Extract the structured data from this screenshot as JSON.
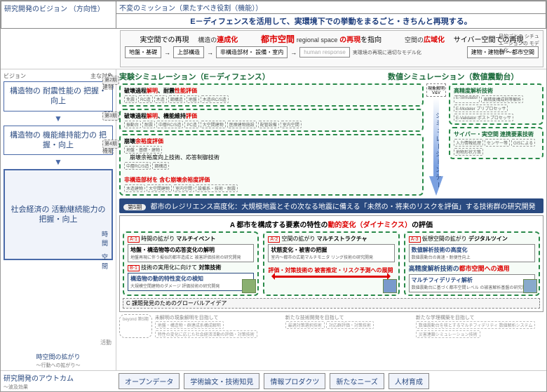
{
  "header": {
    "vision_title": "研究開発のビジョン\n（方向性）",
    "mission_title": "不変のミッション（果たすべき役割（機能））",
    "mission_body": "E－ディフェンスを活用して、実環境下での挙動をまるごと・きちんと再現する。"
  },
  "row2": {
    "t_real": "実空間での再現",
    "t_struct": "構造の",
    "t_speed": "連成化",
    "t_city": "都市空間",
    "t_city_en": "regional space",
    "t_repr": "の再現",
    "t_aim": "を指向",
    "t_wide": "空間の",
    "t_wide2": "広域化",
    "t_cyber": "サイバー空間での再現",
    "b1": "地盤・基礎",
    "b2": "上部構造",
    "b3": "非構造部材・\n設備・室内",
    "b4": "human\nresponse",
    "b_right": "建物・建物群\n～都市空間",
    "caption": "実環境の再現に適切なモデル化",
    "right_cap": "目的ごとの\nシチュエーションの\nモデル化"
  },
  "left": {
    "l_vision": "ビジョン",
    "l_target": "主な対象",
    "box1": "構造物の\n耐震性能の\n把握・向上",
    "box2": "構造物の\n機能維持能力の\n把握・向上",
    "box3": "社会経済の\n活動継続能力の\n把握・向上",
    "bottom": "時空間の拡がり",
    "bottom_sub": "～行動への拡がり～"
  },
  "side": {
    "s2": "建物",
    "s3": "機能",
    "s_ts": "時間\n空間",
    "s_act": "活動"
  },
  "phases": {
    "p2": "第2期",
    "p3": "第3期",
    "p4": "第4期",
    "p5": "第5期",
    "beyond": "beyond\n第5期"
  },
  "sections": {
    "exp": "実験シミュレーション（E－ディフェンス）",
    "num": "数値シミュレーション（数値震動台）"
  },
  "exp_blocks": {
    "b1_t1": "破壊過程",
    "b1_t2": "解明",
    "b1_t3": "、耐震",
    "b1_t4": "性能評価",
    "b1_tags": [
      "免震",
      "RC造",
      "木造",
      "鋼構造",
      "地盤",
      "木造/RC/S造"
    ],
    "b2_t1": "破壊過程",
    "b2_t2": "解明",
    "b2_t3": "、機能維持",
    "b2_t4": "評価",
    "b2_tags": [
      "振動台",
      "耐震",
      "中層RC/S造",
      "PC造",
      "大空間建物",
      "医療建物施設",
      "配管設備",
      "室内空間"
    ],
    "b3_t1": "崩壊",
    "b3_t2": "余裕度評価",
    "b3_tags": [
      "地盤・基礎・建物"
    ],
    "b3_sub": "崩壊余裕度向上技術、応答制御技術",
    "b3_subtags": [
      "中層RC/S造",
      "鋼構造"
    ],
    "b3_t3": "非構造部材を\n含む崩壊余裕度評価",
    "b3_tags2": [
      "木造建物",
      "大空間建物",
      "室内空間",
      "設備系・技術・耐震"
    ]
  },
  "num_blocks": {
    "n1_t": "高精度解析技術",
    "n1_items": [
      "E-Simulator",
      "高精度構成則等解析",
      "E-Modeler\nプリプロセッサ",
      "E-Validator\nポストプロセッサ"
    ],
    "n2_t": "サイバー・実空間\n連携要素技術",
    "n2_items": [
      "入力情報処理",
      "センサー等",
      "GISによる",
      "地物形状方策"
    ]
  },
  "sim": {
    "vv": "現象解明\nV&V",
    "txt": "シミュレーションデータ"
  },
  "p5_band": {
    "label": "第5期",
    "text": "都市のレジリエンス高度化：大規模地震とその次なる地震に備える「未然の・将来のリスクを評価」する技術群の研究開発"
  },
  "a_area": {
    "hdr_pre": "A 都市を構成する要素の特性の",
    "hdr_r": "動的変化（ダイナミクス）",
    "hdr_post": "の評価",
    "a1_label": "A-1",
    "a1_cap": "時間の拡がり",
    "a1_name": "マルチイベント",
    "a1_title": "地盤・構造物等の応答変化の解明",
    "a1_sub": "地盤再現に伴う擬似的都市造成と\n被害評価技術の研究開発",
    "b1_label": "B-1",
    "b1_cap": "技術の実用化に向けて",
    "b1_name": "対策技術",
    "b1_title": "構造物の動的特性変化の検知",
    "b1_sub": "大規模空間建物のダメージ\n評価技術の研究開発",
    "a2_label": "A-2",
    "a2_cap": "空間の拡がり",
    "a2_name": "マルチストラクチャ",
    "a2_title": "状態変化・被害の把握",
    "a2_sub": "室内～都市の広範マルチモニタ\nリング技術の研究開発",
    "mid_text": "評価・対策技術の\n被害推定・リスク予測への展開",
    "a3_label": "A-3",
    "a3_cap": "仮想空間の拡がり",
    "a3_name": "デジタルツイン",
    "a3_t1": "数値解析技術の高度化",
    "a3_s1": "数値震動台の高速・耐便性向上",
    "a3_t2": "高精度解析技術の都市空間への適用",
    "a3_t3": "マルチフィデリティ解析",
    "a3_s3": "数値震動台に基づく都市空間レベル\nの被害解析基盤の研究開発"
  },
  "c_band": "C 課題発見のためのグローバルアイデア",
  "beyond": {
    "h1": "未解明の現象解明を目指して",
    "h2": "新たな技術開発を目指して",
    "h3": "新たな学理構築を目指して",
    "c1": [
      "地盤・構造物・群連成系構成解明",
      "特性の変化に応じた社会経済活動の評価・対策技術"
    ],
    "c2": [
      "最適対策選択技術",
      "対応群評価・対策技術"
    ],
    "c3": [
      "数値震動台を核とするマルチフィデリティ\n数値解析システム",
      "災害連鎖シミュレーション技術"
    ]
  },
  "outcome": {
    "title": "研究開発のアウトカム",
    "sub": "～波及効果",
    "items": [
      "オープンデータ",
      "学術論文・技術知見",
      "情報プロダクツ",
      "新たなニーズ",
      "人材育成"
    ]
  }
}
